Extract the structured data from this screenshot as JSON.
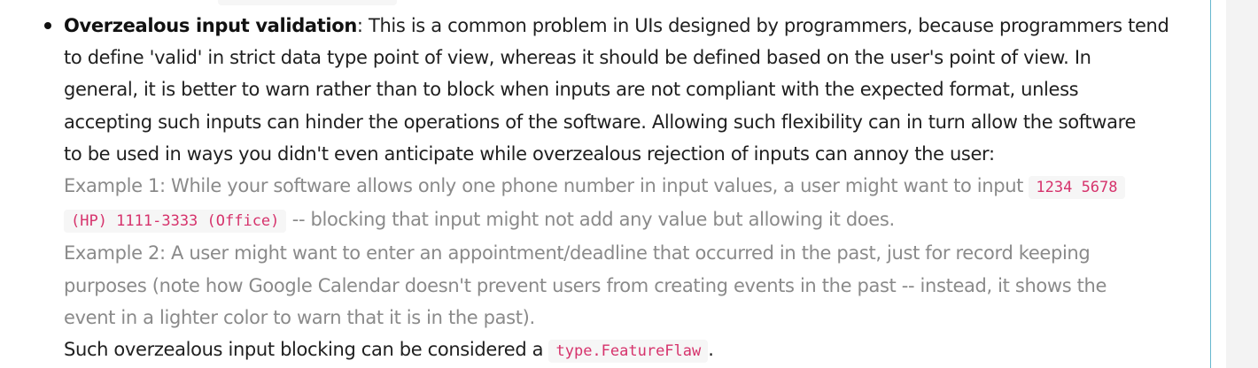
{
  "item": {
    "term": "Overzealous input validation",
    "sep": ":",
    "intro": [
      " This is a common problem in UIs designed by programmers, because programmers tend",
      "to define 'valid' in strict data type point of view, whereas it should be defined based on the user's point of view. In",
      "general, it is better to warn rather than to block when inputs are not compliant with the expected format, unless",
      "accepting such inputs can hinder the operations of the software. Allowing such flexibility can in turn allow the software",
      "to be used in ways you didn't even anticipate while overzealous rejection of inputs can annoy the user:"
    ],
    "example1": {
      "text": "Example 1: While your software allows only one phone number in input values, a user might want to input ",
      "code_part1": "1234 5678",
      "code_part2": "(HP) 1111-3333 (Office)",
      "tail": " -- blocking that input might not add any value but allowing it does."
    },
    "example2": [
      "Example 2: A user might want to enter an appointment/deadline that occurred in the past, just for record keeping",
      "purposes (note how Google Calendar doesn't prevent users from creating events in the past -- instead, it shows the",
      "event in a lighter color to warn that it is in the past)."
    ],
    "conclusion": {
      "text": "Such overzealous input blocking can be considered a ",
      "code": "type.FeatureFlaw",
      "end": "."
    }
  }
}
